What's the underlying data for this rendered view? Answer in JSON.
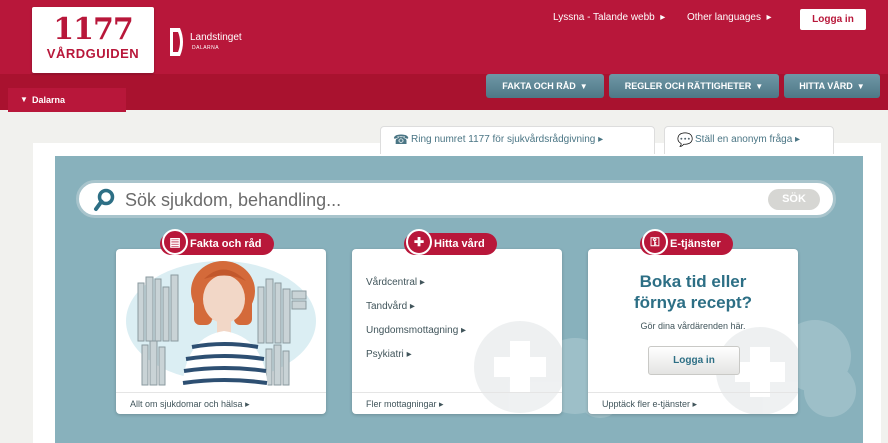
{
  "logo": {
    "number": "1177",
    "name": "VÅRDGUIDEN"
  },
  "landsting": {
    "name": "Landstinget",
    "sub": "DALARNA"
  },
  "top_links": {
    "listen": "Lyssna - Talande webb",
    "languages": "Other languages",
    "login": "Logga in"
  },
  "nav": [
    {
      "label": "FAKTA OCH RÅD"
    },
    {
      "label": "REGLER OCH RÄTTIGHETER"
    },
    {
      "label": "HITTA VÅRD"
    }
  ],
  "region": "Dalarna",
  "tabs": {
    "phone": "Ring numret 1177 för sjukvårdsrådgivning",
    "question": "Ställ en anonym fråga"
  },
  "search": {
    "placeholder": "Sök sjukdom, behandling...",
    "button": "SÖK"
  },
  "cards": {
    "fakta": {
      "title": "Fakta och råd",
      "footer": "Allt om sjukdomar och hälsa"
    },
    "hitta": {
      "title": "Hitta vård",
      "links": [
        "Vårdcentral",
        "Tandvård",
        "Ungdomsmottagning",
        "Psykiatri"
      ],
      "footer": "Fler mottagningar"
    },
    "etjanster": {
      "title": "E-tjänster",
      "heading_line1": "Boka tid eller",
      "heading_line2": "förnya recept?",
      "sub": "Gör dina vårdärenden här.",
      "login": "Logga in",
      "footer": "Upptäck fler e-tjänster"
    }
  },
  "colors": {
    "brand_red": "#b8173a",
    "nav_blue": "#5a8392",
    "hero_blue": "#88b1bc",
    "link_blue": "#2d6f85"
  }
}
